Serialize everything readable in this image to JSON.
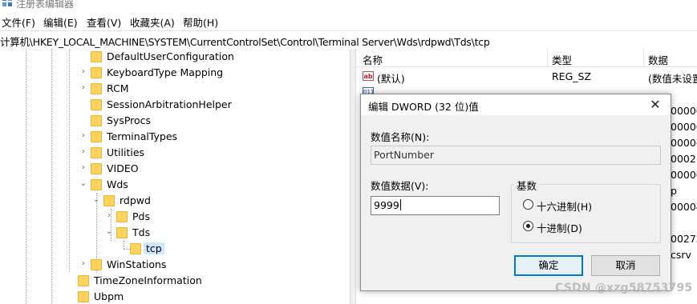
{
  "window": {
    "title": "注册表编辑器"
  },
  "menu": [
    {
      "label": "文件(F)"
    },
    {
      "label": "编辑(E)"
    },
    {
      "label": "查看(V)"
    },
    {
      "label": "收藏夹(A)"
    },
    {
      "label": "帮助(H)"
    }
  ],
  "address": {
    "path": "计算机\\HKEY_LOCAL_MACHINE\\SYSTEM\\CurrentControlSet\\Control\\Terminal Server\\Wds\\rdpwd\\Tds\\tcp"
  },
  "tree": {
    "nodes": [
      {
        "label": "DefaultUserConfiguration",
        "state": "collapsed-none"
      },
      {
        "label": "KeyboardType Mapping",
        "state": "collapsed"
      },
      {
        "label": "RCM",
        "state": "collapsed"
      },
      {
        "label": "SessionArbitrationHelper",
        "state": "none"
      },
      {
        "label": "SysProcs",
        "state": "none"
      },
      {
        "label": "TerminalTypes",
        "state": "collapsed"
      },
      {
        "label": "Utilities",
        "state": "collapsed"
      },
      {
        "label": "VIDEO",
        "state": "collapsed"
      },
      {
        "label": "Wds",
        "state": "expanded"
      },
      {
        "label": "rdpwd",
        "state": "expanded"
      },
      {
        "label": "Pds",
        "state": "collapsed"
      },
      {
        "label": "Tds",
        "state": "expanded"
      },
      {
        "label": "tcp",
        "state": "selected"
      },
      {
        "label": "WinStations",
        "state": "collapsed"
      },
      {
        "label": "TimeZoneInformation",
        "state": "none"
      },
      {
        "label": "Ubpm",
        "state": "none"
      }
    ]
  },
  "list": {
    "headers": {
      "name": "名称",
      "type": "类型",
      "data": "数据"
    },
    "rows": [
      {
        "icon": "string-value-icon",
        "name": "(默认)",
        "type": "REG_SZ",
        "data": "(数值未设置"
      },
      {
        "icon": "binary-value-icon",
        "name": "",
        "type": "",
        "data": ""
      }
    ],
    "data_fragments": [
      "00000",
      "00000",
      "00006",
      "00021",
      "00000",
      "p",
      "00004",
      "00272",
      "csrv"
    ]
  },
  "dialog": {
    "title": "编辑 DWORD (32 位)值",
    "close_symbol": "✕",
    "name_label": "数值名称(N):",
    "name_value": "PortNumber",
    "data_label": "数值数据(V):",
    "data_value": "9999",
    "base_label": "基数",
    "radio_hex": "十六进制(H)",
    "radio_dec": "十进制(D)",
    "selected_base": "decimal",
    "ok_label": "确定",
    "cancel_label": "取消"
  },
  "watermark": "CSDN @xzg58753795",
  "colors": {
    "folder": "#ffd45c",
    "selection": "#cde8ff",
    "default_button_border": "#0078d7"
  }
}
